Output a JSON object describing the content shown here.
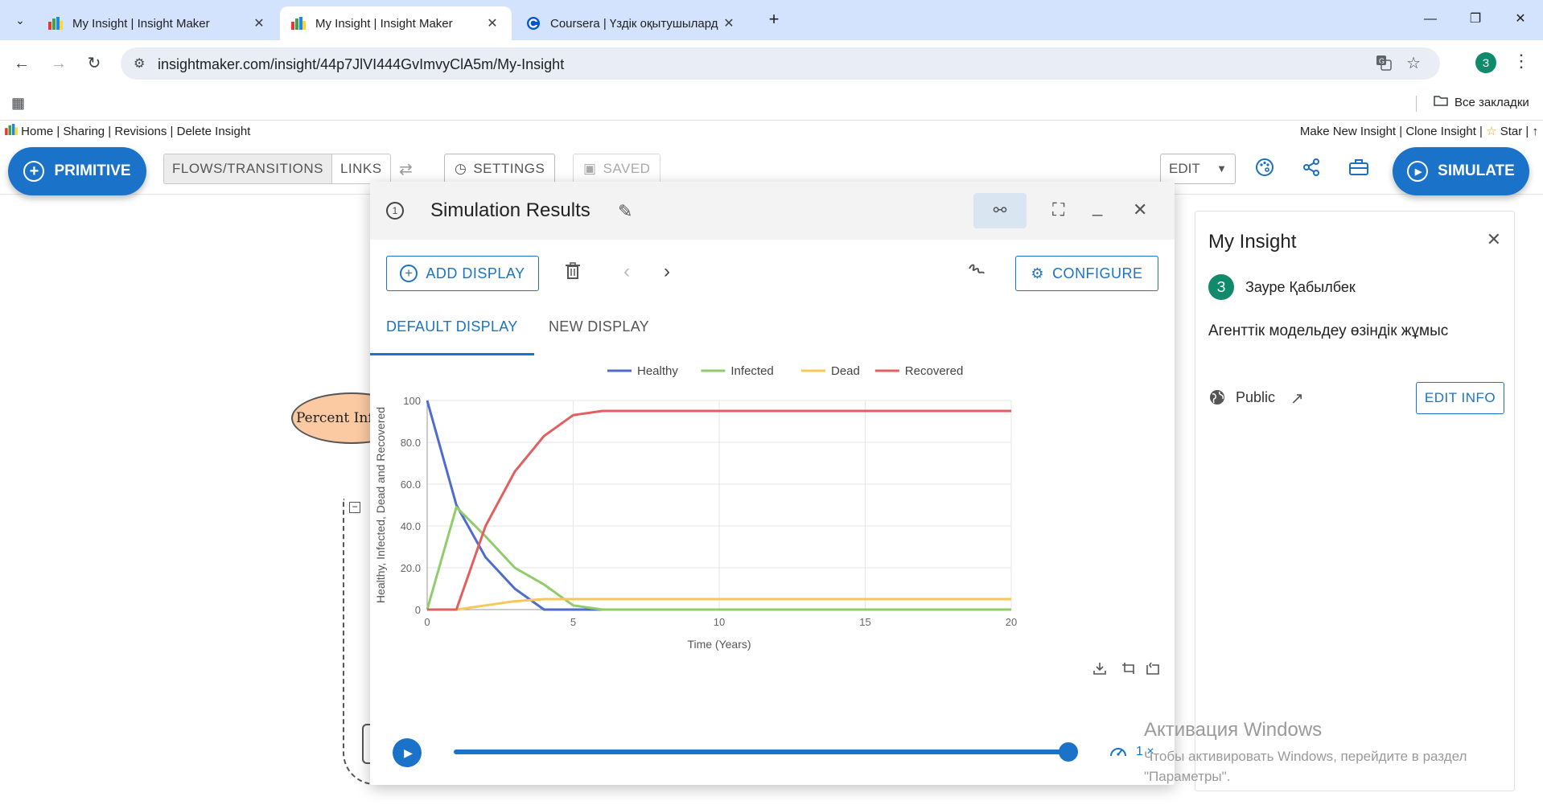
{
  "browser": {
    "tabs": [
      {
        "title": "My Insight | Insight Maker",
        "active": false
      },
      {
        "title": "My Insight | Insight Maker",
        "active": true
      },
      {
        "title": "Coursera | Үздік оқытушылард",
        "active": false
      }
    ],
    "url": "insightmaker.com/insight/44p7JlVI444GvImvyClA5m/My-Insight",
    "profile_initial": "З",
    "bookmarks_label": "Все закладки"
  },
  "app": {
    "top_links": [
      "Home",
      "Sharing",
      "Revisions",
      "Delete Insight"
    ],
    "right_links": [
      "Make New Insight",
      "Clone Insight",
      "Star"
    ],
    "toolbar": {
      "primitive_label": "PRIMITIVE",
      "flows_label": "FLOWS/TRANSITIONS",
      "links_label": "LINKS",
      "settings_label": "SETTINGS",
      "saved_label": "SAVED",
      "edit_label": "EDIT",
      "simulate_label": "SIMULATE"
    },
    "canvas": {
      "ellipse_label": "Percent Inf"
    }
  },
  "sim_window": {
    "title": "Simulation Results",
    "info_glyph": "1",
    "add_display_label": "ADD DISPLAY",
    "configure_label": "CONFIGURE",
    "tabs": [
      "DEFAULT DISPLAY",
      "NEW DISPLAY"
    ],
    "speed_label": "1 ×"
  },
  "chart_data": {
    "type": "line",
    "xlabel": "Time (Years)",
    "ylabel": "Healthy, Infected, Dead and Recovered",
    "xlim": [
      0,
      20
    ],
    "ylim": [
      0,
      100
    ],
    "x_ticks": [
      0,
      5,
      10,
      15,
      20
    ],
    "y_ticks": [
      0,
      20.0,
      40.0,
      60.0,
      80.0,
      100
    ],
    "y_tick_labels": [
      "0",
      "20.0",
      "40.0",
      "60.0",
      "80.0",
      "100"
    ],
    "grid": true,
    "legend_position": "top",
    "x": [
      0,
      1,
      2,
      3,
      4,
      5,
      6,
      7,
      8,
      9,
      10,
      11,
      12,
      13,
      14,
      15,
      16,
      17,
      18,
      19,
      20
    ],
    "series": [
      {
        "name": "Healthy",
        "color": "#4f6bcc",
        "values": [
          100,
          50,
          25,
          10,
          0,
          0,
          0,
          0,
          0,
          0,
          0,
          0,
          0,
          0,
          0,
          0,
          0,
          0,
          0,
          0,
          0
        ]
      },
      {
        "name": "Infected",
        "color": "#8fcc6a",
        "values": [
          0,
          49,
          35,
          20,
          12,
          2,
          0,
          0,
          0,
          0,
          0,
          0,
          0,
          0,
          0,
          0,
          0,
          0,
          0,
          0,
          0
        ]
      },
      {
        "name": "Dead",
        "color": "#f7c75a",
        "values": [
          0,
          0,
          2,
          4,
          5,
          5,
          5,
          5,
          5,
          5,
          5,
          5,
          5,
          5,
          5,
          5,
          5,
          5,
          5,
          5,
          5
        ]
      },
      {
        "name": "Recovered",
        "color": "#e35f5f",
        "values": [
          0,
          0,
          40,
          66,
          83,
          93,
          95,
          95,
          95,
          95,
          95,
          95,
          95,
          95,
          95,
          95,
          95,
          95,
          95,
          95,
          95
        ]
      }
    ]
  },
  "info_panel": {
    "title": "My Insight",
    "author_initial": "З",
    "author": "Зауре Қабылбек",
    "description": "Агенттік модельдеу өзіндік жұмыс",
    "visibility": "Public",
    "edit_info_label": "EDIT INFO"
  },
  "watermark": {
    "line1": "Активация Windows",
    "line2": "Чтобы активировать Windows, перейдите в раздел \"Параметры\"."
  }
}
